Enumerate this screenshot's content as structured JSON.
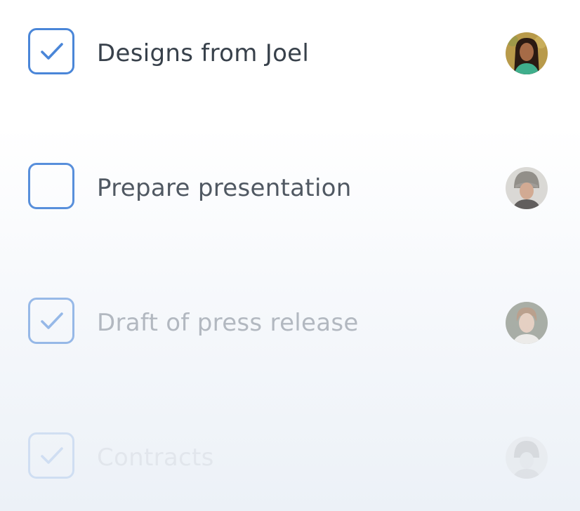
{
  "tasks": [
    {
      "label": "Designs from Joel",
      "checked": true,
      "avatar": {
        "name": "avatar-woman-dark-hair-icon",
        "background": "#b89a4a",
        "hair": "#2a1a12",
        "skin": "#a66b47",
        "clothing": "#3fae8c"
      }
    },
    {
      "label": "Prepare presentation",
      "checked": false,
      "avatar": {
        "name": "avatar-woman-beanie-icon",
        "background": "#d8d6d2",
        "hair": "#8a8680",
        "skin": "#cfa48a",
        "clothing": "#555150"
      }
    },
    {
      "label": "Draft of press release",
      "checked": true,
      "avatar": {
        "name": "avatar-man-brown-hair-icon",
        "background": "#6b7262",
        "hair": "#8a5a35",
        "skin": "#d8b096",
        "clothing": "#e6e3dc"
      }
    },
    {
      "label": "Contracts",
      "checked": true,
      "avatar": {
        "name": "avatar-woman-hat-icon",
        "background": "#cfcfcf",
        "hair": "#6d6d6d",
        "skin": "#bdbdbd",
        "clothing": "#9a9a9a"
      }
    }
  ],
  "colors": {
    "accent": "#4a86d8",
    "text_primary": "#38414b"
  }
}
